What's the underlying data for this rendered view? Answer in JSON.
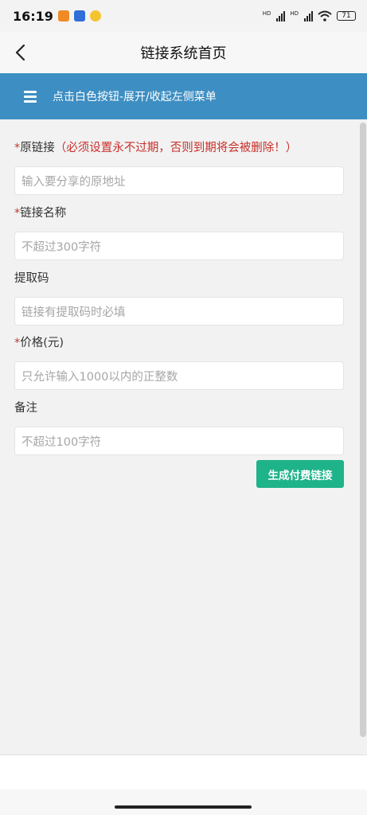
{
  "status_bar": {
    "time": "16:19",
    "battery": "71",
    "signal_label_1": "HD",
    "signal_label_2": "HD",
    "icons": [
      "app-orange-icon",
      "app-blue-icon",
      "app-yellow-icon",
      "signal-icon",
      "signal-icon",
      "wifi-icon",
      "battery-icon"
    ]
  },
  "header": {
    "title": "链接系统首页",
    "back_icon": "chevron-left-icon"
  },
  "banner": {
    "text": "点击白色按钮-展开/收起左侧菜单",
    "menu_icon": "hamburger-icon",
    "color": "#3d8ec2"
  },
  "form": {
    "fields": [
      {
        "required": "*",
        "label": "原链接",
        "note": "（必须设置永不过期，否则到期将会被删除！）",
        "placeholder": "输入要分享的原地址"
      },
      {
        "required": "*",
        "label": "链接名称",
        "placeholder": "不超过300字符"
      },
      {
        "required": "",
        "label": "提取码",
        "placeholder": "链接有提取码时必填"
      },
      {
        "required": "*",
        "label": "价格(元)",
        "placeholder": "只允许输入1000以内的正整数"
      },
      {
        "required": "",
        "label": "备注",
        "placeholder": "不超过100字符"
      }
    ],
    "submit_label": "生成付费链接",
    "submit_color": "#1fb38a"
  }
}
